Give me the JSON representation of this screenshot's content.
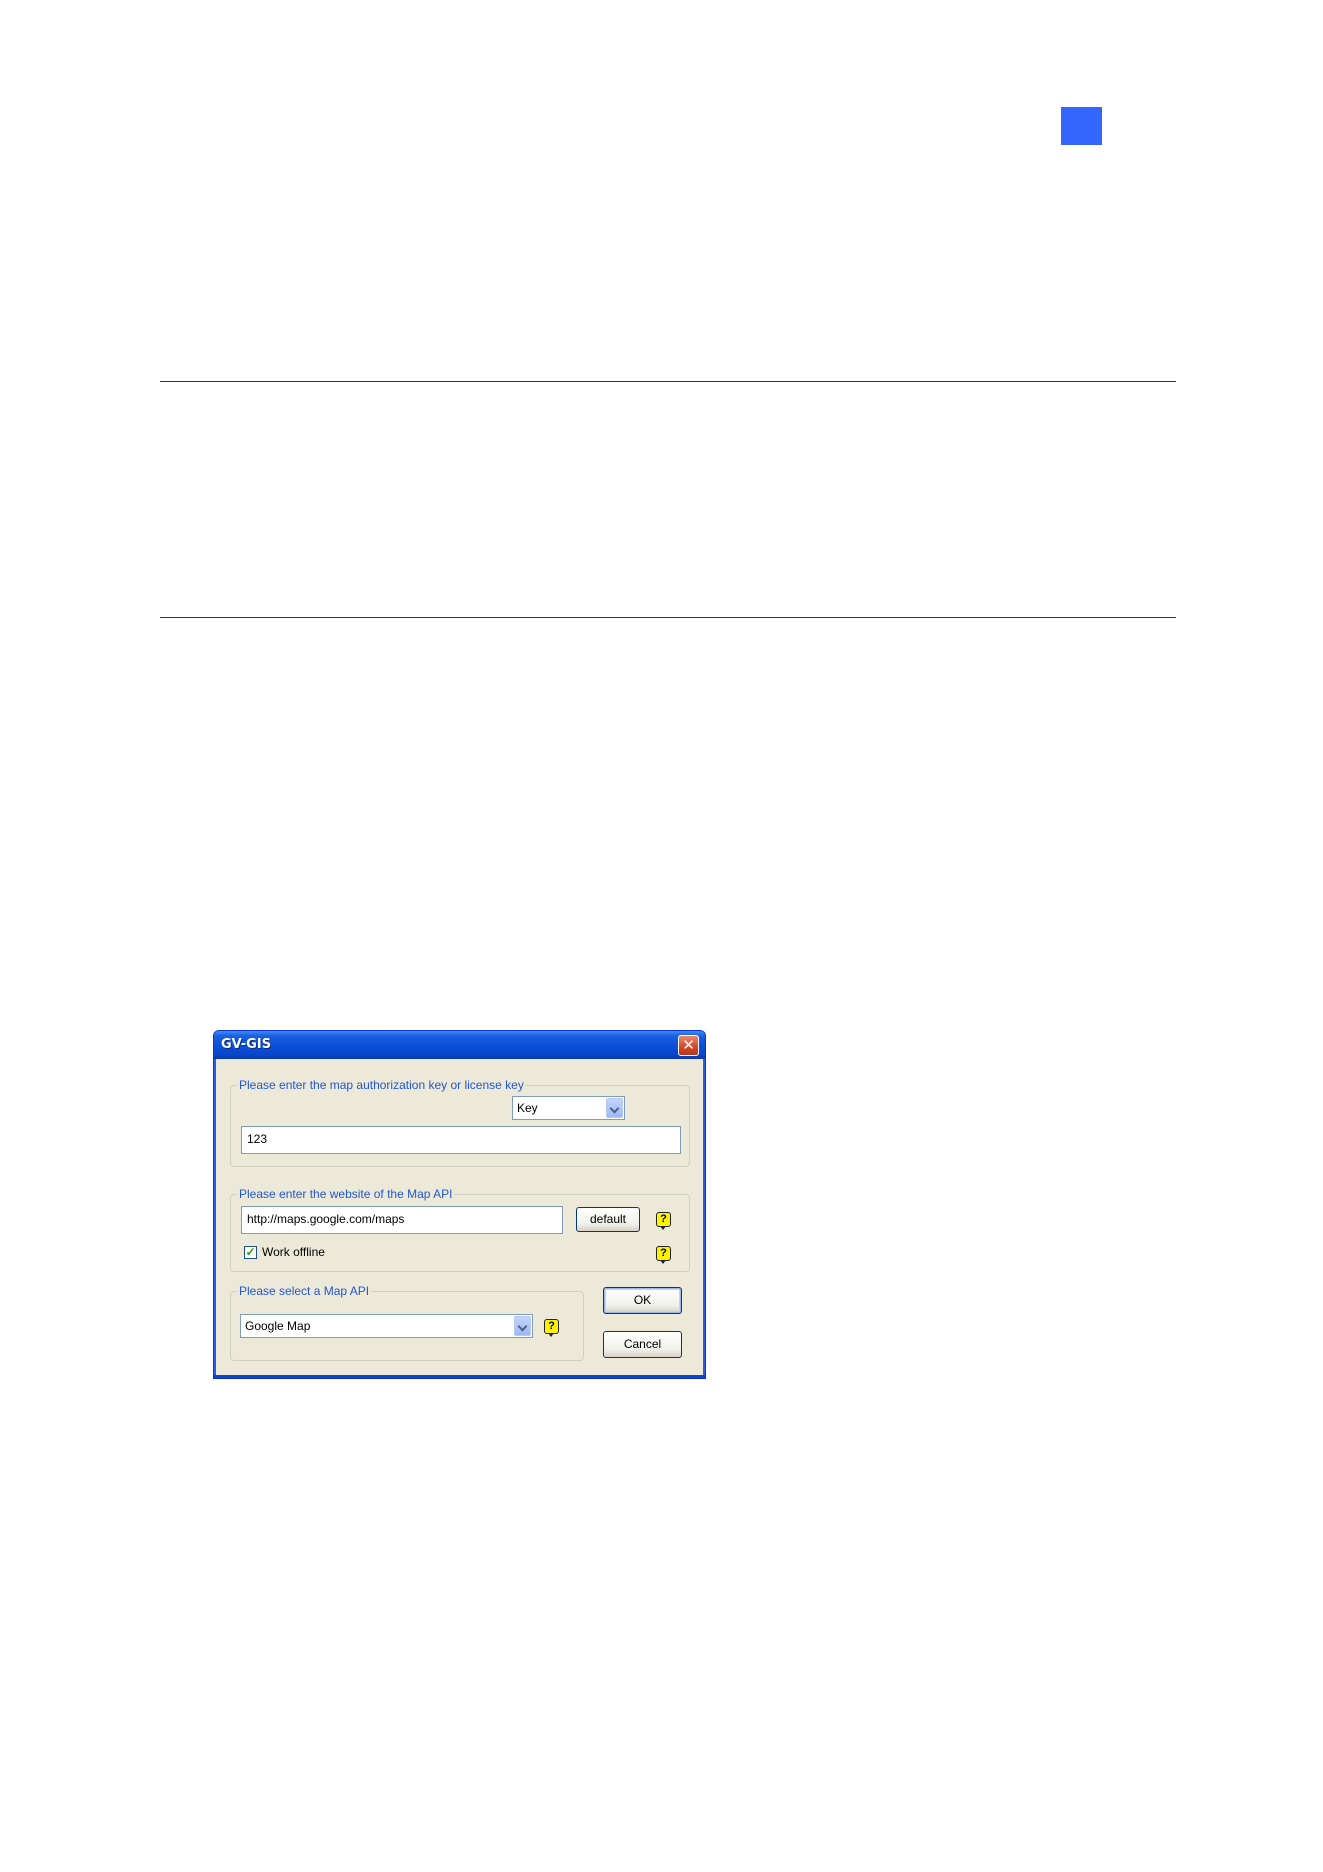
{
  "dialog": {
    "title": "GV-GIS",
    "close_glyph": "✕",
    "auth_group": {
      "legend": "Please enter the map authorization key or license key",
      "key_type_selected": "Key",
      "key_value": "123"
    },
    "website_group": {
      "legend": "Please enter the website of the Map API",
      "url_value": "http://maps.google.com/maps",
      "default_button": "default",
      "work_offline_label": "Work offline",
      "work_offline_checked": true
    },
    "api_group": {
      "legend": "Please select a Map API",
      "selected_api": "Google Map"
    },
    "ok_button": "OK",
    "cancel_button": "Cancel",
    "help_glyph": "?",
    "check_glyph": "✓"
  },
  "colors": {
    "chapter_badge": "#3366ff",
    "legend_text": "#2157d8",
    "help_icon": "#fff200"
  }
}
